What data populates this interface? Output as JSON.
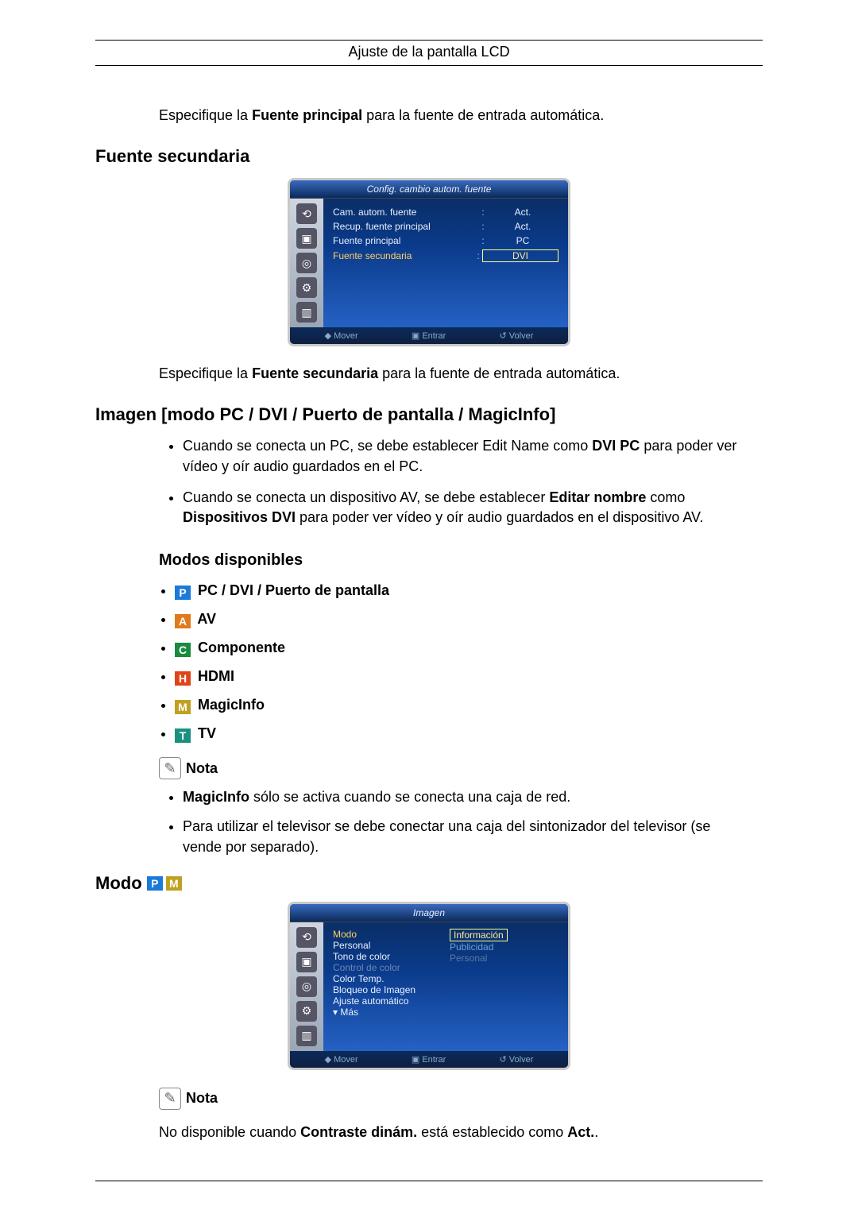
{
  "header": {
    "title": "Ajuste de la pantalla LCD"
  },
  "intro1_pre": "Especifique la ",
  "intro1_bold": "Fuente principal",
  "intro1_post": " para la fuente de entrada automática.",
  "section_fuente_secundaria": "Fuente secundaria",
  "osd1": {
    "title": "Config. cambio autom. fuente",
    "rows": [
      {
        "label": "Cam. autom. fuente",
        "value": "Act."
      },
      {
        "label": "Recup. fuente principal",
        "value": "Act."
      },
      {
        "label": "Fuente principal",
        "value": "PC"
      },
      {
        "label": "Fuente secundaria",
        "value": "DVI",
        "highlight": true
      }
    ],
    "footer": {
      "move": "Mover",
      "enter": "Entrar",
      "back": "Volver"
    }
  },
  "intro2_pre": "Especifique la ",
  "intro2_bold": "Fuente secundaria",
  "intro2_post": " para la fuente de entrada automática.",
  "section_imagen": "Imagen [modo PC / DVI / Puerto de pantalla / MagicInfo]",
  "bullets_imagen": {
    "b1_a": "Cuando se conecta un PC, se debe establecer Edit Name como ",
    "b1_b": "DVI PC",
    "b1_c": " para poder ver vídeo y oír audio guardados en el PC.",
    "b2_a": "Cuando se conecta un dispositivo AV, se debe establecer ",
    "b2_b": "Editar nombre",
    "b2_c": " como ",
    "b2_d": "Dispositivos DVI",
    "b2_e": " para poder ver vídeo y oír audio guardados en el dispositivo AV."
  },
  "modos_heading": "Modos disponibles",
  "modes": {
    "p": "PC / DVI / Puerto de pantalla",
    "a": "AV",
    "c": "Componente",
    "h": "HDMI",
    "m": "MagicInfo",
    "t": "TV"
  },
  "nota_label": "Nota",
  "nota1_bullets": {
    "n1_a": "MagicInfo",
    "n1_b": " sólo se activa cuando se conecta una caja de red.",
    "n2": "Para utilizar el televisor se debe conectar una caja del sintonizador del televisor (se vende por separado)."
  },
  "modo_heading": "Modo",
  "osd2": {
    "title": "Imagen",
    "left": [
      "Modo",
      "Personal",
      "Tono de color",
      "Control de color",
      "Color Temp.",
      "Bloqueo de Imagen",
      "Ajuste automático",
      "▾ Más"
    ],
    "right": [
      "Información",
      "Publicidad",
      "Personal"
    ],
    "footer": {
      "move": "Mover",
      "enter": "Entrar",
      "back": "Volver"
    }
  },
  "final_a": "No disponible cuando ",
  "final_b": "Contraste dinám.",
  "final_c": " está establecido como ",
  "final_d": "Act.",
  "final_e": "."
}
